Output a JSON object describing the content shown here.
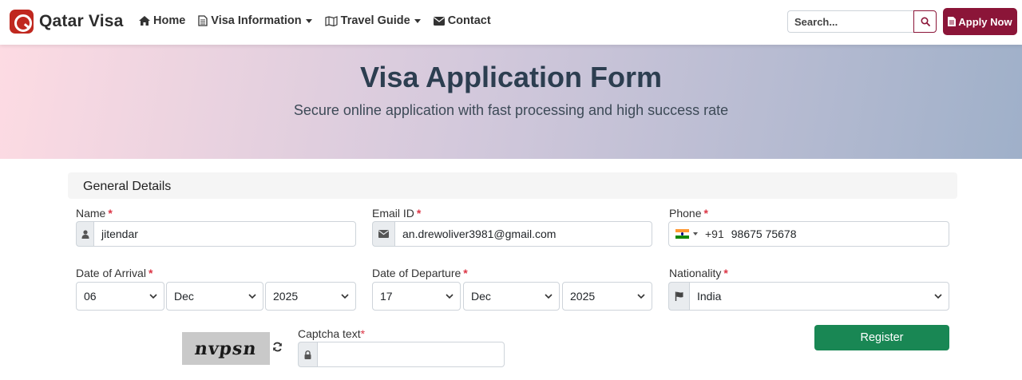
{
  "brand": {
    "name": "Qatar Visa"
  },
  "nav": {
    "home": "Home",
    "visa_info": "Visa Information",
    "travel_guide": "Travel Guide",
    "contact": "Contact"
  },
  "search": {
    "placeholder": "Search..."
  },
  "apply_button": "Apply Now",
  "hero": {
    "title": "Visa Application Form",
    "subtitle": "Secure online application with fast processing and high success rate"
  },
  "form": {
    "section_title": "General Details",
    "name": {
      "label": "Name",
      "required": "*",
      "value": "jitendar"
    },
    "email": {
      "label": "Email ID",
      "required": "*",
      "value": "an.drewoliver3981@gmail.com"
    },
    "phone": {
      "label": "Phone",
      "required": "*",
      "dial_code": "+91",
      "value": "98675 75678"
    },
    "arrival": {
      "label": "Date of Arrival",
      "required": "*",
      "day": "06",
      "month": "Dec",
      "year": "2025"
    },
    "departure": {
      "label": "Date of Departure",
      "required": "*",
      "day": "17",
      "month": "Dec",
      "year": "2025"
    },
    "nationality": {
      "label": "Nationality",
      "required": "*",
      "value": "India"
    },
    "captcha": {
      "image_text": "nvpsn",
      "label": "Captcha text",
      "required": "*",
      "value": ""
    },
    "register_button": "Register"
  },
  "colors": {
    "brand": "#c0281f",
    "accent": "#8b1538",
    "success": "#198754",
    "required": "#dc3545"
  },
  "icons": [
    "home-icon",
    "file-icon",
    "map-icon",
    "envelope-icon",
    "search-icon",
    "user-icon",
    "flag-icon",
    "refresh-icon",
    "lock-icon"
  ]
}
